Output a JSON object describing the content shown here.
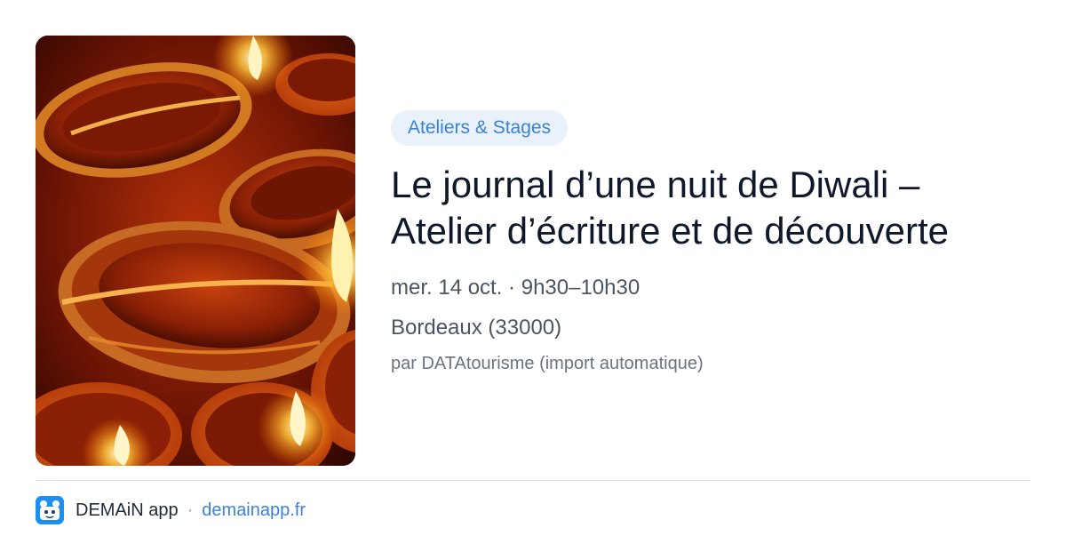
{
  "event": {
    "category": "Ateliers & Stages",
    "title": "Le journal d’une nuit de Diwali – Atelier d’écriture et de découverte",
    "date_time": "mer. 14 oct. · 9h30–10h30",
    "location": "Bordeaux (33000)",
    "source": "par DATAtourisme (import automatique)",
    "image": "diwali-oil-lamps-photo"
  },
  "footer": {
    "app_name": "DEMAiN app",
    "separator": "·",
    "link": "demainapp.fr",
    "logo": "demain-app-logo-icon"
  },
  "colors": {
    "accent": "#3b82d6",
    "badge_background": "#e9f1fb",
    "title": "#0f172a",
    "logo_background": "#1d8ff0"
  }
}
